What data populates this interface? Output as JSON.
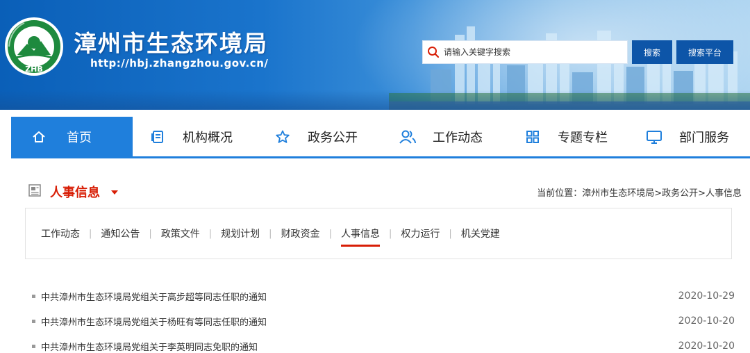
{
  "header": {
    "site_title": "漳州市生态环境局",
    "site_url": "http://hbj.zhangzhou.gov.cn/",
    "logo_text": "ZHB",
    "search_placeholder": "请输入关键字搜索",
    "search_button": "搜索",
    "platform_button": "搜索平台"
  },
  "nav": {
    "items": [
      {
        "label": "首页",
        "icon": "home-icon"
      },
      {
        "label": "机构概况",
        "icon": "document-icon"
      },
      {
        "label": "政务公开",
        "icon": "star-icon"
      },
      {
        "label": "工作动态",
        "icon": "users-icon"
      },
      {
        "label": "专题专栏",
        "icon": "grid-icon"
      },
      {
        "label": "部门服务",
        "icon": "monitor-icon"
      }
    ],
    "active_index": 0
  },
  "section": {
    "title": "人事信息",
    "breadcrumb": "当前位置：漳州市生态环境局>政务公开>人事信息"
  },
  "subtabs": {
    "items": [
      "工作动态",
      "通知公告",
      "政策文件",
      "规划计划",
      "财政资金",
      "人事信息",
      "权力运行",
      "机关党建"
    ],
    "active": "人事信息"
  },
  "articles": [
    {
      "title": "中共漳州市生态环境局党组关于高步超等同志任职的通知",
      "date": "2020-10-29"
    },
    {
      "title": "中共漳州市生态环境局党组关于杨旺有等同志任职的通知",
      "date": "2020-10-20"
    },
    {
      "title": "中共漳州市生态环境局党组关于李英明同志免职的通知",
      "date": "2020-10-20"
    }
  ],
  "colors": {
    "banner": "#1a74cc",
    "nav_active": "#1f7fdc",
    "accent_red": "#d81e06",
    "button": "#0d55a8"
  }
}
